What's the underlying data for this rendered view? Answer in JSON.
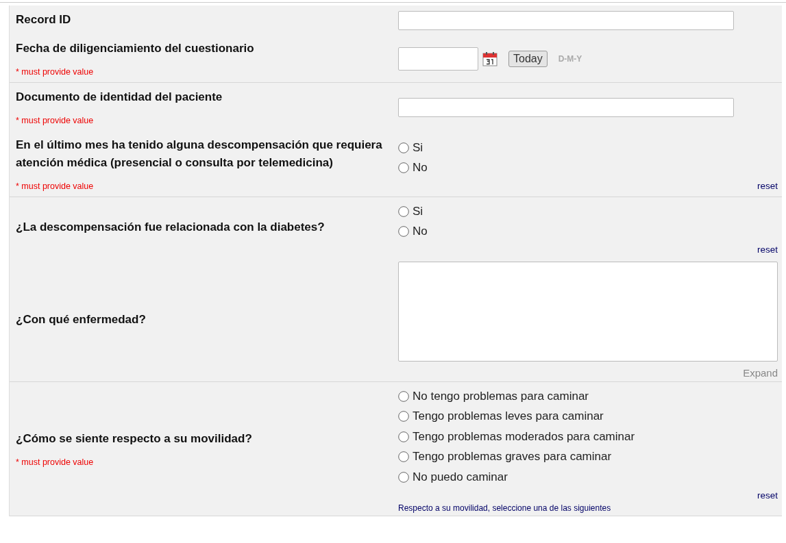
{
  "sections": [
    {
      "fields": [
        {
          "kind": "text",
          "label": "Record ID"
        },
        {
          "kind": "date",
          "label": "Fecha de diligenciamiento del cuestionario",
          "required_note": "* must provide value",
          "today_button": "Today",
          "format": "D-M-Y"
        }
      ]
    },
    {
      "fields": [
        {
          "kind": "text",
          "label": "Documento de identidad del paciente",
          "required_note": "* must provide value"
        },
        {
          "kind": "radio",
          "label": "En el último mes ha tenido alguna descompensación que requiera atención médica (presencial o consulta por telemedicina)",
          "required_note": "* must provide value",
          "options": [
            {
              "label": "Si",
              "selected": false
            },
            {
              "label": "No",
              "selected": false
            }
          ],
          "reset": "reset"
        }
      ]
    },
    {
      "fields": [
        {
          "kind": "radio",
          "label": "¿La descompensación fue relacionada con la diabetes?",
          "options": [
            {
              "label": "Si",
              "selected": false
            },
            {
              "label": "No",
              "selected": false
            }
          ],
          "reset": "reset"
        },
        {
          "kind": "textarea",
          "label": "¿Con qué enfermedad?",
          "expand": "Expand"
        }
      ]
    },
    {
      "fields": [
        {
          "kind": "radio",
          "label": "¿Cómo se siente respecto a su movilidad?",
          "required_note": "* must provide value",
          "options": [
            {
              "label": "No tengo problemas para caminar",
              "selected": false
            },
            {
              "label": "Tengo problemas leves para caminar",
              "selected": false
            },
            {
              "label": "Tengo problemas moderados para caminar",
              "selected": false
            },
            {
              "label": "Tengo problemas graves para caminar",
              "selected": false
            },
            {
              "label": "No puedo caminar",
              "selected": false
            }
          ],
          "reset": "reset",
          "note": "Respecto a su movilidad, seleccione una de las siguientes"
        }
      ]
    }
  ]
}
